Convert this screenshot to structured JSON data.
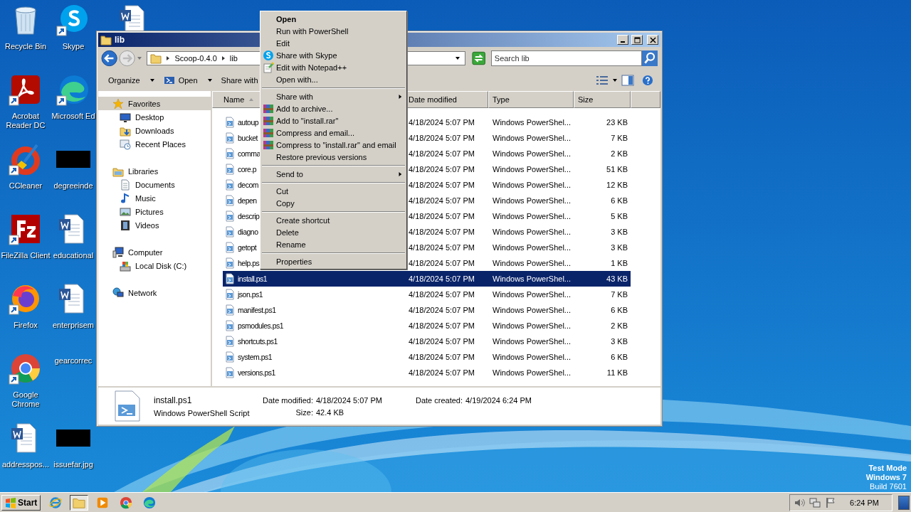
{
  "desktop": {
    "columns": [
      [
        {
          "label": "Recycle Bin",
          "kind": "recycle",
          "shortcut": false
        },
        {
          "label": "Acrobat Reader DC",
          "kind": "pdf",
          "shortcut": true
        },
        {
          "label": "CCleaner",
          "kind": "ccleaner",
          "shortcut": true
        },
        {
          "label": "FileZilla Client",
          "kind": "filezilla",
          "shortcut": true
        },
        {
          "label": "Firefox",
          "kind": "firefox",
          "shortcut": true
        },
        {
          "label": "Google Chrome",
          "kind": "chrome",
          "shortcut": true
        },
        {
          "label": "addresspos...",
          "kind": "word",
          "shortcut": false
        }
      ],
      [
        {
          "label": "Skype",
          "kind": "skype",
          "shortcut": true
        },
        {
          "label": "Microsoft Ed",
          "kind": "edge",
          "shortcut": true
        },
        {
          "label": "degreeinde",
          "kind": "black"
        },
        {
          "label": "educational",
          "kind": "word",
          "shortcut": false
        },
        {
          "label": "enterprisem",
          "kind": "word",
          "shortcut": false
        },
        {
          "label": "gearcorrec",
          "kind": "none"
        },
        {
          "label": "issuefar.jpg",
          "kind": "black"
        }
      ],
      [
        {
          "kind": "word",
          "shortcut": false
        }
      ]
    ],
    "watermark": [
      "Test Mode",
      "Windows 7",
      "Build 7601"
    ]
  },
  "window": {
    "title": "lib",
    "address": {
      "crumbs": [
        "Scoop-0.4.0",
        "lib"
      ],
      "search_placeholder": "Search lib"
    },
    "toolbar": [
      {
        "label": "Organize",
        "kind": "plain",
        "dropdown": true
      },
      {
        "label": "Open",
        "kind": "powershell",
        "dropdown": true
      },
      {
        "label": "Share with",
        "kind": "plain",
        "dropdown": false
      }
    ],
    "nav": [
      {
        "label": "Favorites",
        "kind": "star",
        "selected": true,
        "children": [
          {
            "label": "Desktop",
            "kind": "desktop",
            "selected": false
          },
          {
            "label": "Downloads",
            "kind": "downloads",
            "selected": false
          },
          {
            "label": "Recent Places",
            "kind": "recent",
            "selected": false
          }
        ]
      },
      {
        "label": "Libraries",
        "kind": "library",
        "selected": false,
        "children": [
          {
            "label": "Documents",
            "kind": "documents",
            "selected": false
          },
          {
            "label": "Music",
            "kind": "music",
            "selected": false
          },
          {
            "label": "Pictures",
            "kind": "pictures",
            "selected": false
          },
          {
            "label": "Videos",
            "kind": "videos",
            "selected": false
          }
        ]
      },
      {
        "label": "Computer",
        "kind": "computer",
        "selected": false,
        "children": [
          {
            "label": "Local Disk (C:)",
            "kind": "disk",
            "selected": false
          }
        ]
      },
      {
        "label": "Network",
        "kind": "network",
        "selected": false
      }
    ],
    "columns": [
      "Name",
      "Date modified",
      "Type",
      "Size"
    ],
    "rows": [
      {
        "name": "autoup",
        "date": "4/18/2024 5:07 PM",
        "type": "Windows PowerShel...",
        "size": "23 KB",
        "selected": false
      },
      {
        "name": "bucket",
        "date": "4/18/2024 5:07 PM",
        "type": "Windows PowerShel...",
        "size": "7 KB",
        "selected": false
      },
      {
        "name": "comma",
        "date": "4/18/2024 5:07 PM",
        "type": "Windows PowerShel...",
        "size": "2 KB",
        "selected": false
      },
      {
        "name": "core.p",
        "date": "4/18/2024 5:07 PM",
        "type": "Windows PowerShel...",
        "size": "51 KB",
        "selected": false
      },
      {
        "name": "decom",
        "date": "4/18/2024 5:07 PM",
        "type": "Windows PowerShel...",
        "size": "12 KB",
        "selected": false
      },
      {
        "name": "depen",
        "date": "4/18/2024 5:07 PM",
        "type": "Windows PowerShel...",
        "size": "6 KB",
        "selected": false
      },
      {
        "name": "descrip",
        "date": "4/18/2024 5:07 PM",
        "type": "Windows PowerShel...",
        "size": "5 KB",
        "selected": false
      },
      {
        "name": "diagno",
        "date": "4/18/2024 5:07 PM",
        "type": "Windows PowerShel...",
        "size": "3 KB",
        "selected": false
      },
      {
        "name": "getopt",
        "date": "4/18/2024 5:07 PM",
        "type": "Windows PowerShel...",
        "size": "3 KB",
        "selected": false
      },
      {
        "name": "help.ps",
        "date": "4/18/2024 5:07 PM",
        "type": "Windows PowerShel...",
        "size": "1 KB",
        "selected": false
      },
      {
        "name": "install.ps1",
        "date": "4/18/2024 5:07 PM",
        "type": "Windows PowerShel...",
        "size": "43 KB",
        "selected": true
      },
      {
        "name": "json.ps1",
        "date": "4/18/2024 5:07 PM",
        "type": "Windows PowerShel...",
        "size": "7 KB",
        "selected": false
      },
      {
        "name": "manifest.ps1",
        "date": "4/18/2024 5:07 PM",
        "type": "Windows PowerShel...",
        "size": "6 KB",
        "selected": false
      },
      {
        "name": "psmodules.ps1",
        "date": "4/18/2024 5:07 PM",
        "type": "Windows PowerShel...",
        "size": "2 KB",
        "selected": false
      },
      {
        "name": "shortcuts.ps1",
        "date": "4/18/2024 5:07 PM",
        "type": "Windows PowerShel...",
        "size": "3 KB",
        "selected": false
      },
      {
        "name": "system.ps1",
        "date": "4/18/2024 5:07 PM",
        "type": "Windows PowerShel...",
        "size": "6 KB",
        "selected": false
      },
      {
        "name": "versions.ps1",
        "date": "4/18/2024 5:07 PM",
        "type": "Windows PowerShel...",
        "size": "11 KB",
        "selected": false
      }
    ],
    "details": {
      "name": "install.ps1",
      "type": "Windows PowerShell Script",
      "fields": [
        {
          "label": "Date modified:",
          "value": "4/18/2024 5:07 PM"
        },
        {
          "label": "Size:",
          "value": "42.4 KB"
        },
        {
          "label": "Date created:",
          "value": "4/19/2024 6:24 PM"
        }
      ]
    }
  },
  "context_menu": [
    [
      {
        "label": "Open",
        "kind": "plain",
        "default": true,
        "submenu": false
      },
      {
        "label": "Run with PowerShell",
        "kind": "plain",
        "default": false,
        "submenu": false
      },
      {
        "label": "Edit",
        "kind": "plain",
        "default": false,
        "submenu": false
      },
      {
        "label": "Share with Skype",
        "kind": "skype",
        "default": false,
        "submenu": false
      },
      {
        "label": "Edit with Notepad++",
        "kind": "notepad",
        "default": false,
        "submenu": false
      },
      {
        "label": "Open with...",
        "kind": "plain",
        "default": false,
        "submenu": false
      }
    ],
    [
      {
        "label": "Share with",
        "kind": "plain",
        "default": false,
        "submenu": true
      },
      {
        "label": "Add to archive...",
        "kind": "archive",
        "default": false,
        "submenu": false
      },
      {
        "label": "Add to \"install.rar\"",
        "kind": "archive",
        "default": false,
        "submenu": false
      },
      {
        "label": "Compress and email...",
        "kind": "archive",
        "default": false,
        "submenu": false
      },
      {
        "label": "Compress to \"install.rar\" and email",
        "kind": "archive",
        "default": false,
        "submenu": false
      },
      {
        "label": "Restore previous versions",
        "kind": "plain",
        "default": false,
        "submenu": false
      }
    ],
    [
      {
        "label": "Send to",
        "kind": "plain",
        "default": false,
        "submenu": true
      }
    ],
    [
      {
        "label": "Cut",
        "kind": "plain",
        "default": false,
        "submenu": false
      },
      {
        "label": "Copy",
        "kind": "plain",
        "default": false,
        "submenu": false
      }
    ],
    [
      {
        "label": "Create shortcut",
        "kind": "plain",
        "default": false,
        "submenu": false
      },
      {
        "label": "Delete",
        "kind": "plain",
        "default": false,
        "submenu": false
      },
      {
        "label": "Rename",
        "kind": "plain",
        "default": false,
        "submenu": false
      }
    ],
    [
      {
        "label": "Properties",
        "kind": "plain",
        "default": false,
        "submenu": false
      }
    ]
  ],
  "taskbar": {
    "start": "Start",
    "apps": [
      {
        "kind": "ie",
        "selected": false
      },
      {
        "kind": "folder",
        "selected": true
      },
      {
        "kind": "media",
        "selected": false
      },
      {
        "kind": "chrome",
        "selected": false
      },
      {
        "kind": "edge",
        "selected": false
      }
    ],
    "time": "6:24 PM"
  }
}
